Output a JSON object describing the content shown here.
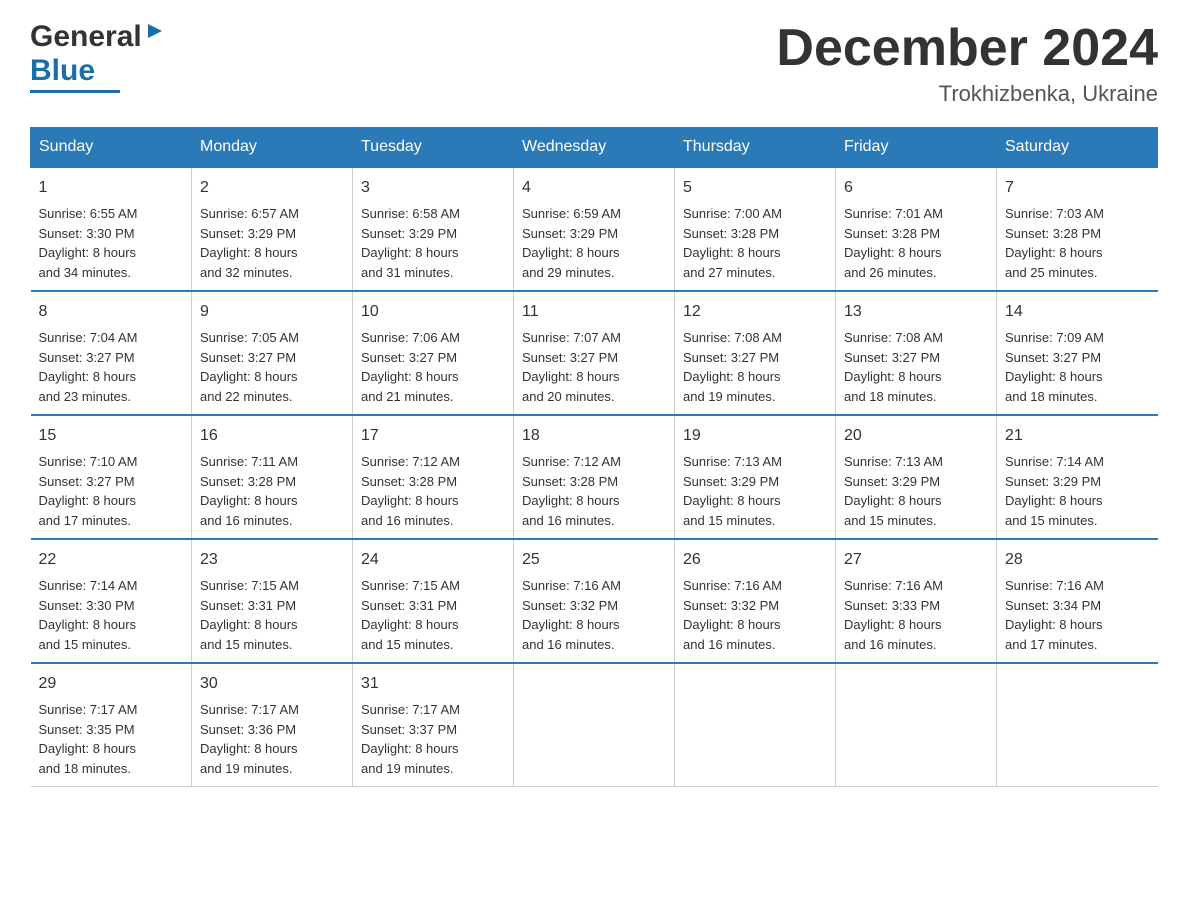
{
  "logo": {
    "general": "General",
    "blue": "Blue"
  },
  "header": {
    "month": "December 2024",
    "location": "Trokhizbenka, Ukraine"
  },
  "weekdays": [
    "Sunday",
    "Monday",
    "Tuesday",
    "Wednesday",
    "Thursday",
    "Friday",
    "Saturday"
  ],
  "weeks": [
    [
      {
        "day": "1",
        "sunrise": "6:55 AM",
        "sunset": "3:30 PM",
        "daylight": "8 hours and 34 minutes."
      },
      {
        "day": "2",
        "sunrise": "6:57 AM",
        "sunset": "3:29 PM",
        "daylight": "8 hours and 32 minutes."
      },
      {
        "day": "3",
        "sunrise": "6:58 AM",
        "sunset": "3:29 PM",
        "daylight": "8 hours and 31 minutes."
      },
      {
        "day": "4",
        "sunrise": "6:59 AM",
        "sunset": "3:29 PM",
        "daylight": "8 hours and 29 minutes."
      },
      {
        "day": "5",
        "sunrise": "7:00 AM",
        "sunset": "3:28 PM",
        "daylight": "8 hours and 27 minutes."
      },
      {
        "day": "6",
        "sunrise": "7:01 AM",
        "sunset": "3:28 PM",
        "daylight": "8 hours and 26 minutes."
      },
      {
        "day": "7",
        "sunrise": "7:03 AM",
        "sunset": "3:28 PM",
        "daylight": "8 hours and 25 minutes."
      }
    ],
    [
      {
        "day": "8",
        "sunrise": "7:04 AM",
        "sunset": "3:27 PM",
        "daylight": "8 hours and 23 minutes."
      },
      {
        "day": "9",
        "sunrise": "7:05 AM",
        "sunset": "3:27 PM",
        "daylight": "8 hours and 22 minutes."
      },
      {
        "day": "10",
        "sunrise": "7:06 AM",
        "sunset": "3:27 PM",
        "daylight": "8 hours and 21 minutes."
      },
      {
        "day": "11",
        "sunrise": "7:07 AM",
        "sunset": "3:27 PM",
        "daylight": "8 hours and 20 minutes."
      },
      {
        "day": "12",
        "sunrise": "7:08 AM",
        "sunset": "3:27 PM",
        "daylight": "8 hours and 19 minutes."
      },
      {
        "day": "13",
        "sunrise": "7:08 AM",
        "sunset": "3:27 PM",
        "daylight": "8 hours and 18 minutes."
      },
      {
        "day": "14",
        "sunrise": "7:09 AM",
        "sunset": "3:27 PM",
        "daylight": "8 hours and 18 minutes."
      }
    ],
    [
      {
        "day": "15",
        "sunrise": "7:10 AM",
        "sunset": "3:27 PM",
        "daylight": "8 hours and 17 minutes."
      },
      {
        "day": "16",
        "sunrise": "7:11 AM",
        "sunset": "3:28 PM",
        "daylight": "8 hours and 16 minutes."
      },
      {
        "day": "17",
        "sunrise": "7:12 AM",
        "sunset": "3:28 PM",
        "daylight": "8 hours and 16 minutes."
      },
      {
        "day": "18",
        "sunrise": "7:12 AM",
        "sunset": "3:28 PM",
        "daylight": "8 hours and 16 minutes."
      },
      {
        "day": "19",
        "sunrise": "7:13 AM",
        "sunset": "3:29 PM",
        "daylight": "8 hours and 15 minutes."
      },
      {
        "day": "20",
        "sunrise": "7:13 AM",
        "sunset": "3:29 PM",
        "daylight": "8 hours and 15 minutes."
      },
      {
        "day": "21",
        "sunrise": "7:14 AM",
        "sunset": "3:29 PM",
        "daylight": "8 hours and 15 minutes."
      }
    ],
    [
      {
        "day": "22",
        "sunrise": "7:14 AM",
        "sunset": "3:30 PM",
        "daylight": "8 hours and 15 minutes."
      },
      {
        "day": "23",
        "sunrise": "7:15 AM",
        "sunset": "3:31 PM",
        "daylight": "8 hours and 15 minutes."
      },
      {
        "day": "24",
        "sunrise": "7:15 AM",
        "sunset": "3:31 PM",
        "daylight": "8 hours and 15 minutes."
      },
      {
        "day": "25",
        "sunrise": "7:16 AM",
        "sunset": "3:32 PM",
        "daylight": "8 hours and 16 minutes."
      },
      {
        "day": "26",
        "sunrise": "7:16 AM",
        "sunset": "3:32 PM",
        "daylight": "8 hours and 16 minutes."
      },
      {
        "day": "27",
        "sunrise": "7:16 AM",
        "sunset": "3:33 PM",
        "daylight": "8 hours and 16 minutes."
      },
      {
        "day": "28",
        "sunrise": "7:16 AM",
        "sunset": "3:34 PM",
        "daylight": "8 hours and 17 minutes."
      }
    ],
    [
      {
        "day": "29",
        "sunrise": "7:17 AM",
        "sunset": "3:35 PM",
        "daylight": "8 hours and 18 minutes."
      },
      {
        "day": "30",
        "sunrise": "7:17 AM",
        "sunset": "3:36 PM",
        "daylight": "8 hours and 19 minutes."
      },
      {
        "day": "31",
        "sunrise": "7:17 AM",
        "sunset": "3:37 PM",
        "daylight": "8 hours and 19 minutes."
      },
      null,
      null,
      null,
      null
    ]
  ],
  "labels": {
    "sunrise": "Sunrise:",
    "sunset": "Sunset:",
    "daylight": "Daylight:"
  }
}
